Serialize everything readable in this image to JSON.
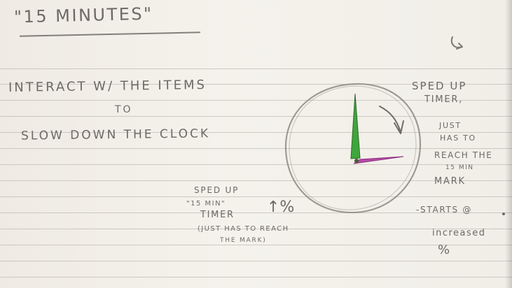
{
  "note": {
    "title": "\"15 MINUTES\"",
    "left_lines": [
      "INTERACT W/ THE ITEMS",
      "TO",
      "SLOW DOWN THE CLOCK"
    ],
    "middle_notes": [
      "SPED UP",
      "\"15 MIN\"",
      "TIMER",
      "↑%",
      "(JUST HAS TO REACH",
      "THE MARK)"
    ],
    "right_notes": [
      "SPED UP",
      "TIMER,",
      "JUST",
      "HAS TO",
      "REACH THE",
      "15 MIN",
      "MARK",
      "-STARTS @",
      "increased",
      "%"
    ]
  },
  "colors": {
    "paper": "#f1eee8",
    "rule": "#b7b3ad",
    "ink": "#6f6b66",
    "clock_outline": "#8b8781",
    "minute_hand": "#3fa63b",
    "hour_hand": "#b64ca7"
  }
}
